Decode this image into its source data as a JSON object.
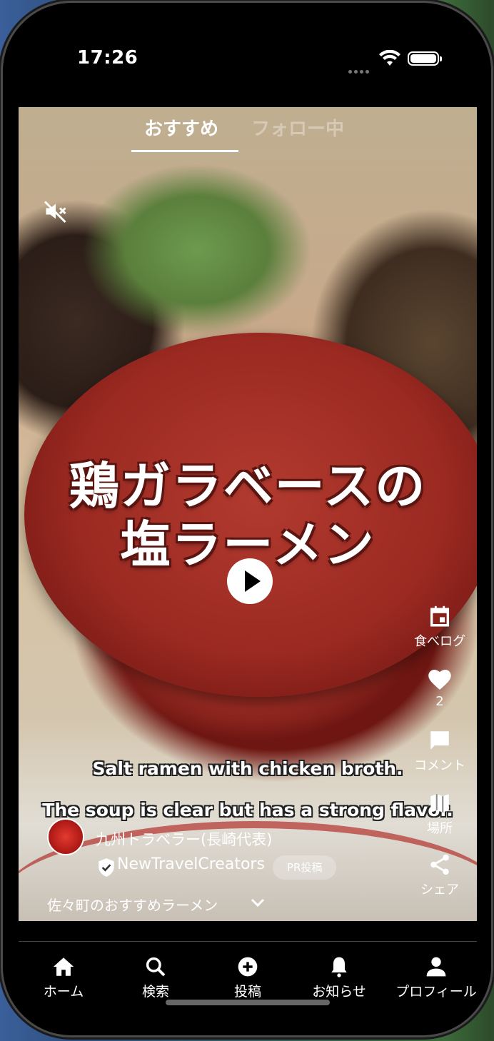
{
  "status_bar": {
    "time": "17:26"
  },
  "feed_tabs": {
    "recommended": "おすすめ",
    "following": "フォロー中"
  },
  "video": {
    "overlay_title_line1": "鶏ガラベースの",
    "overlay_title_line2": "塩ラーメン",
    "subtitle_line1": "Salt ramen with chicken broth.",
    "subtitle_line2": "The soup is clear but has a strong flavor."
  },
  "side_actions": {
    "tabelog_label": "食べログ",
    "like_count": "2",
    "comment_label": "コメント",
    "place_label": "場所",
    "share_label": "シェア"
  },
  "post": {
    "author": "九州トラベラー(長崎代表)",
    "organization": "NewTravelCreators",
    "pr_badge": "PR投稿",
    "playlist": "佐々町のおすすめラーメン"
  },
  "bottom_nav": {
    "home": "ホーム",
    "search": "検索",
    "post": "投稿",
    "notifications": "お知らせ",
    "profile": "プロフィール"
  }
}
